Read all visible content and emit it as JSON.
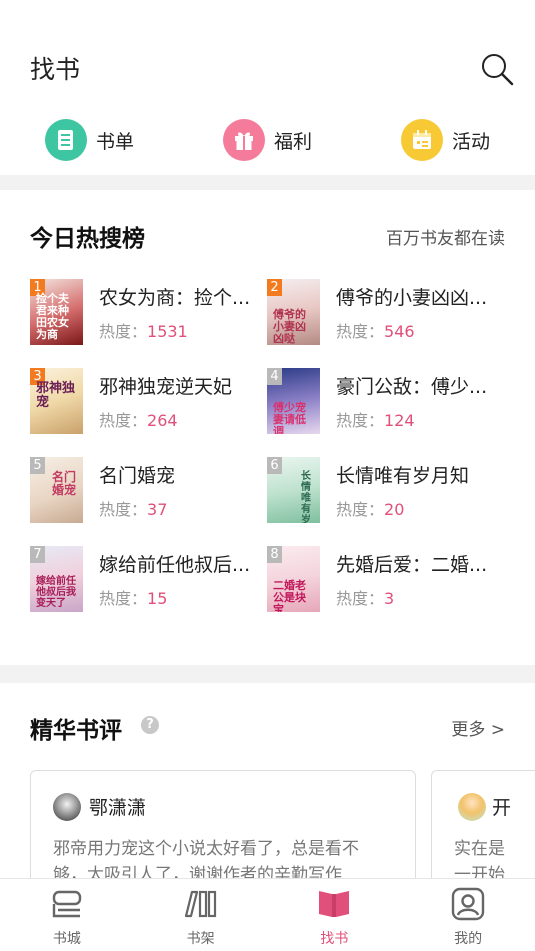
{
  "header": {
    "title": "找书"
  },
  "quick_links": [
    {
      "label": "书单",
      "icon": "book-list-icon",
      "color": "#3ec6a3"
    },
    {
      "label": "福利",
      "icon": "gift-icon",
      "color": "#f47c9a"
    },
    {
      "label": "活动",
      "icon": "calendar-icon",
      "color": "#f7c934"
    }
  ],
  "hot_search": {
    "title": "今日热搜榜",
    "subtitle": "百万书友都在读",
    "heat_label": "热度：",
    "items": [
      {
        "rank": "1",
        "title": "农女为商：捡个...",
        "heat": "1531",
        "cover_text": "捡个夫君来种田农女为商"
      },
      {
        "rank": "2",
        "title": "傅爷的小妻凶凶...",
        "heat": "546",
        "cover_text": "傅爷的小妻凶凶哒"
      },
      {
        "rank": "3",
        "title": "邪神独宠逆天妃",
        "heat": "264",
        "cover_text": "邪神独宠"
      },
      {
        "rank": "4",
        "title": "豪门公敌：傅少...",
        "heat": "124",
        "cover_text": "傅少宠妻请低调"
      },
      {
        "rank": "5",
        "title": "名门婚宠",
        "heat": "37",
        "cover_text": "名门婚宠"
      },
      {
        "rank": "6",
        "title": "长情唯有岁月知",
        "heat": "20",
        "cover_text": "长情唯有岁月知"
      },
      {
        "rank": "7",
        "title": "嫁给前任他叔后...",
        "heat": "15",
        "cover_text": "嫁给前任他叔后我变天了"
      },
      {
        "rank": "8",
        "title": "先婚后爱：二婚...",
        "heat": "3",
        "cover_text": "二婚老公是块宝"
      }
    ]
  },
  "reviews": {
    "title": "精华书评",
    "more": "更多 >",
    "cards": [
      {
        "user": "鄂潇潇",
        "text": "邪帝用力宠这个小说太好看了，总是看不够，太吸引人了，谢谢作者的辛勤写作"
      },
      {
        "user": "开",
        "text": "实在是一开始"
      }
    ]
  },
  "tabs": [
    {
      "label": "书城",
      "icon": "bookstore-icon",
      "active": false
    },
    {
      "label": "书架",
      "icon": "bookshelf-icon",
      "active": false
    },
    {
      "label": "找书",
      "icon": "find-book-icon",
      "active": true
    },
    {
      "label": "我的",
      "icon": "profile-icon",
      "active": false
    }
  ],
  "colors": {
    "accent": "#e0507a",
    "rank_top": "#f47a1f",
    "rank_other": "#b9b9b9"
  }
}
